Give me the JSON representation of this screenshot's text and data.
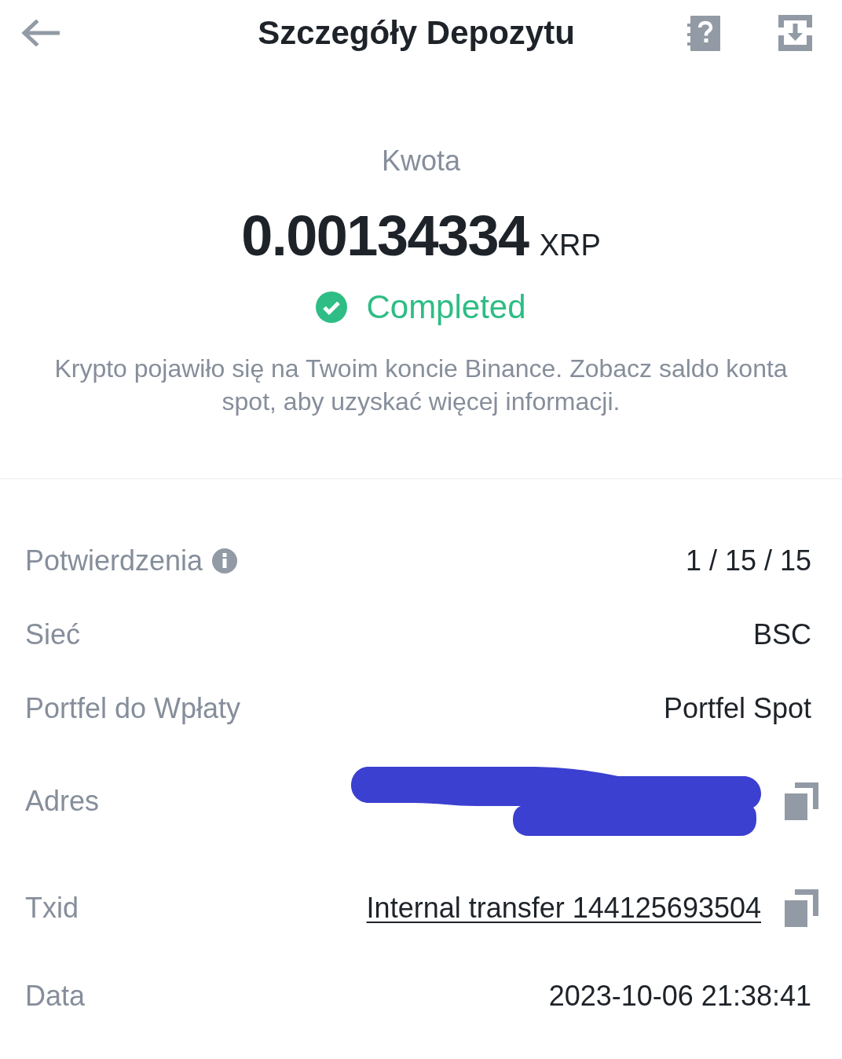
{
  "header": {
    "title": "Szczegóły Depozytu"
  },
  "summary": {
    "amount_label": "Kwota",
    "amount": "0.00134334",
    "currency": "XRP",
    "status": {
      "kind": "completed",
      "label": "Completed"
    },
    "message": "Krypto pojawiło się na Twoim koncie Binance. Zobacz saldo konta spot, aby uzyskać więcej informacji."
  },
  "details": [
    {
      "kind": "info",
      "label": "Potwierdzenia",
      "value": "1 / 15 / 15"
    },
    {
      "kind": "plain",
      "label": "Sieć",
      "value": "BSC"
    },
    {
      "kind": "plain",
      "label": "Portfel do Wpłaty",
      "value": "Portfel Spot"
    },
    {
      "kind": "redacted",
      "label": "Adres"
    },
    {
      "kind": "link",
      "label": "Txid",
      "value": "Internal transfer 144125693504"
    },
    {
      "kind": "plain",
      "label": "Data",
      "value": "2023-10-06 21:38:41"
    }
  ]
}
